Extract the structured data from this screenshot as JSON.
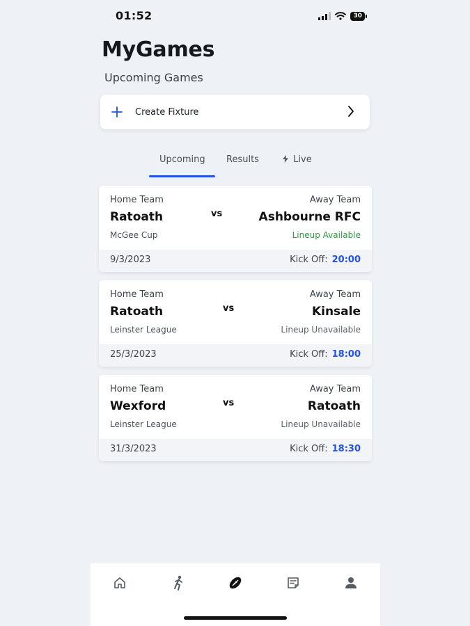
{
  "status_bar": {
    "time": "01:52",
    "battery": "30"
  },
  "header": {
    "title": "MyGames",
    "subtitle": "Upcoming Games"
  },
  "create_fixture": {
    "label": "Create Fixture"
  },
  "tabs": [
    {
      "label": "Upcoming",
      "active": true
    },
    {
      "label": "Results",
      "active": false
    },
    {
      "label": "Live",
      "active": false,
      "icon": "bolt-icon"
    }
  ],
  "fixtures": [
    {
      "home_label": "Home Team",
      "away_label": "Away Team",
      "home_team": "Ratoath",
      "away_team": "Ashbourne RFC",
      "vs": "vs",
      "competition": "McGee Cup",
      "lineup": "Lineup Available",
      "date": "9/3/2023",
      "kick_off_label": "Kick Off:",
      "kick_off_time": "20:00"
    },
    {
      "home_label": "Home Team",
      "away_label": "Away Team",
      "home_team": "Ratoath",
      "away_team": "Kinsale",
      "vs": "vs",
      "competition": "Leinster League",
      "lineup": "Lineup Unavailable",
      "date": "25/3/2023",
      "kick_off_label": "Kick Off:",
      "kick_off_time": "18:00"
    },
    {
      "home_label": "Home Team",
      "away_label": "Away Team",
      "home_team": "Wexford",
      "away_team": "Ratoath",
      "vs": "vs",
      "competition": "Leinster League",
      "lineup": "Lineup Unavailable",
      "date": "31/3/2023",
      "kick_off_label": "Kick Off:",
      "kick_off_time": "18:30"
    }
  ],
  "bottom_nav": [
    {
      "icon": "home-icon",
      "active": false
    },
    {
      "icon": "player-icon",
      "active": false
    },
    {
      "icon": "rugby-ball-icon",
      "active": true
    },
    {
      "icon": "notes-icon",
      "active": false
    },
    {
      "icon": "profile-icon",
      "active": false
    }
  ],
  "colors": {
    "accent": "#2353e6",
    "available": "#2e9a3e",
    "background": "#eef1f5"
  }
}
